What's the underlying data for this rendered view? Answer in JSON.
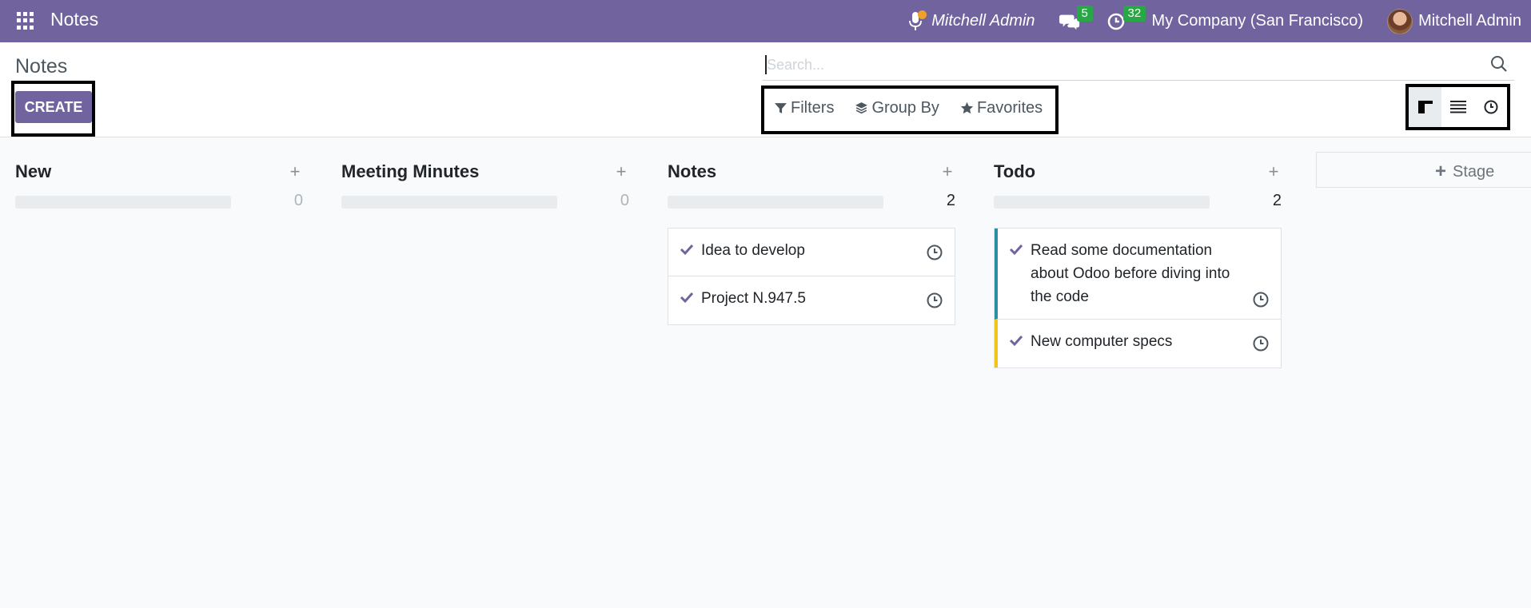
{
  "navbar": {
    "app_title": "Notes",
    "voice_user": "Mitchell Admin",
    "messages_count": "5",
    "activities_count": "32",
    "company": "My Company (San Francisco)",
    "user": "Mitchell Admin",
    "brand_color": "#71639e"
  },
  "control_panel": {
    "title": "Notes",
    "create_label": "CREATE",
    "search_placeholder": "Search...",
    "filters_label": "Filters",
    "group_by_label": "Group By",
    "favorites_label": "Favorites",
    "views": [
      "kanban-view",
      "list-view",
      "activity-view"
    ],
    "active_view": "kanban-view"
  },
  "kanban": {
    "columns": [
      {
        "title": "New",
        "count": "0",
        "cards": []
      },
      {
        "title": "Meeting Minutes",
        "count": "0",
        "cards": []
      },
      {
        "title": "Notes",
        "count": "2",
        "cards": [
          {
            "text": "Idea to develop"
          },
          {
            "text": "Project N.947.5"
          }
        ]
      },
      {
        "title": "Todo",
        "count": "2",
        "cards": [
          {
            "text": "Read some documentation about Odoo before diving into the code",
            "color": "#2b8fa3"
          },
          {
            "text": "New computer specs",
            "color": "#f0c419"
          }
        ]
      }
    ],
    "add_stage_label": "Stage"
  }
}
